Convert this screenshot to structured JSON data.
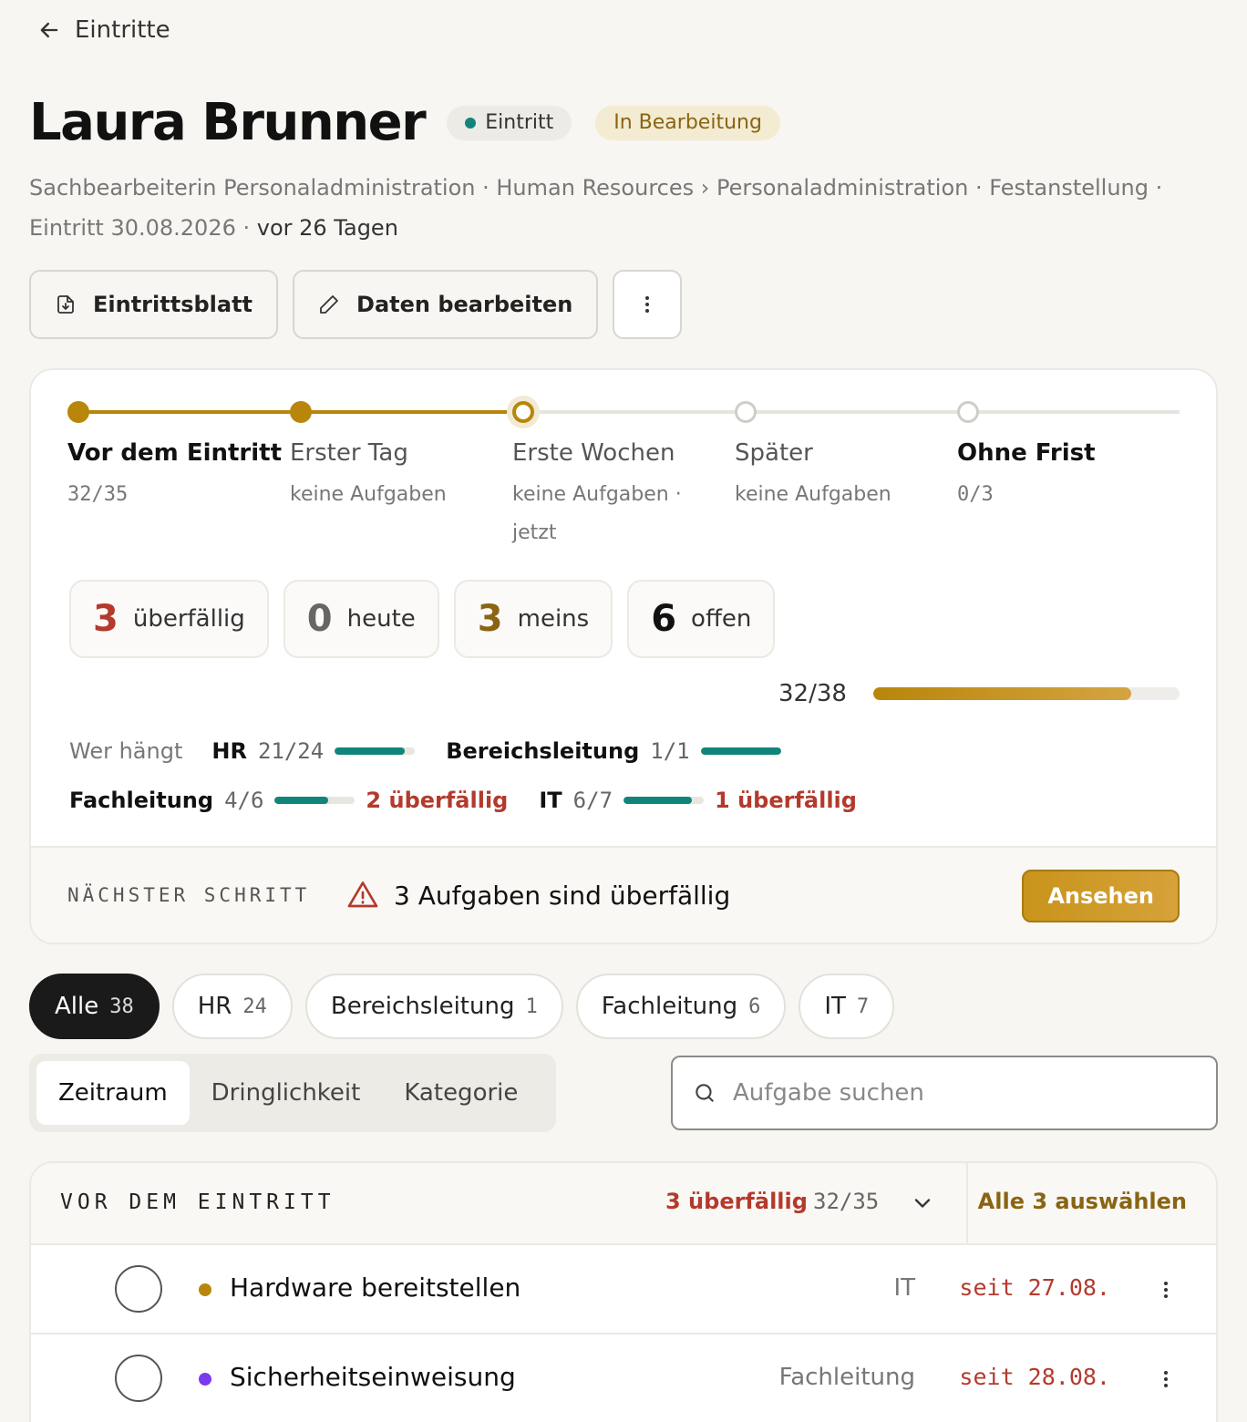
{
  "nav": {
    "back_label": "Eintritte"
  },
  "header": {
    "name": "Laura Brunner",
    "type_badge": "Eintritt",
    "status_badge": "In Bearbeitung",
    "subtitle": "Sachbearbeiterin Personaladministration · Human Resources › Personaladministration · Festanstellung · Eintritt 30.08.2026 ·",
    "relative_date": "vor 26 Tagen"
  },
  "actions": {
    "sheet_label": "Eintrittsblatt",
    "edit_label": "Daten bearbeiten"
  },
  "timeline": {
    "phases": [
      {
        "name": "Vor dem Eintritt",
        "sub": "32/35",
        "state": "done"
      },
      {
        "name": "Erster Tag",
        "sub": "keine Aufgaben",
        "state": "done"
      },
      {
        "name": "Erste Wochen",
        "sub": "keine Aufgaben · jetzt",
        "state": "current"
      },
      {
        "name": "Später",
        "sub": "keine Aufgaben",
        "state": "future"
      },
      {
        "name": "Ohne Frist",
        "sub": "0/3",
        "state": "future"
      }
    ]
  },
  "stats": [
    {
      "value": "3",
      "label": "überfällig",
      "color": "#b33a2c"
    },
    {
      "value": "0",
      "label": "heute",
      "color": "#666666"
    },
    {
      "value": "3",
      "label": "meins",
      "color": "#8a6412"
    },
    {
      "value": "6",
      "label": "offen",
      "color": "#111111"
    }
  ],
  "progress": {
    "label": "32/38",
    "fraction": 0.842
  },
  "who": {
    "label": "Wer hängt",
    "groups": [
      {
        "name": "HR",
        "value": "21/24",
        "fraction": 0.875,
        "overdue": ""
      },
      {
        "name": "Bereichsleitung",
        "value": "1/1",
        "fraction": 1.0,
        "overdue": ""
      },
      {
        "name": "Fachleitung",
        "value": "4/6",
        "fraction": 0.667,
        "overdue": "2 überfällig"
      },
      {
        "name": "IT",
        "value": "6/7",
        "fraction": 0.857,
        "overdue": "1 überfällig"
      }
    ]
  },
  "next_step": {
    "label": "NÄCHSTER SCHRITT",
    "message": "3 Aufgaben sind überfällig",
    "button": "Ansehen"
  },
  "filters": {
    "chips": [
      {
        "label": "Alle",
        "count": "38",
        "active": true
      },
      {
        "label": "HR",
        "count": "24",
        "active": false
      },
      {
        "label": "Bereichsleitung",
        "count": "1",
        "active": false
      },
      {
        "label": "Fachleitung",
        "count": "6",
        "active": false
      },
      {
        "label": "IT",
        "count": "7",
        "active": false
      }
    ],
    "segments": [
      "Zeitraum",
      "Dringlichkeit",
      "Kategorie"
    ],
    "search_placeholder": "Aufgabe suchen"
  },
  "task_group": {
    "title": "VOR DEM EINTRITT",
    "overdue": "3 überfällig",
    "count": "32/35",
    "select_all": "Alle 3 auswählen",
    "tasks": [
      {
        "title": "Hardware bereitstellen",
        "group": "IT",
        "date": "seit 27.08.",
        "dot_color": "#b8860b"
      },
      {
        "title": "Sicherheitseinweisung",
        "group": "Fachleitung",
        "date": "seit 28.08.",
        "dot_color": "#7c3aed"
      }
    ]
  },
  "colors": {
    "accent": "#b8860b",
    "teal": "#12857a",
    "danger": "#b33a2c"
  }
}
